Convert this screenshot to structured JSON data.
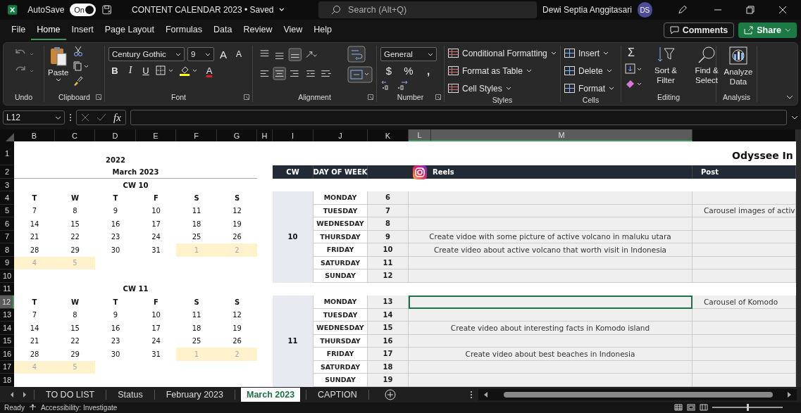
{
  "window": {
    "title": "CONTENT CALENDAR 2023 • Saved",
    "autosave": {
      "label": "AutoSave",
      "state_label": "On",
      "on": true
    },
    "search_placeholder": "Search (Alt+Q)",
    "user": "Dewi Septia Anggitasari",
    "initials": "DS"
  },
  "menu": [
    {
      "label": "File",
      "selected": false
    },
    {
      "label": "Home",
      "selected": true
    },
    {
      "label": "Insert",
      "selected": false
    },
    {
      "label": "Page Layout",
      "selected": false
    },
    {
      "label": "Formulas",
      "selected": false
    },
    {
      "label": "Data",
      "selected": false
    },
    {
      "label": "Review",
      "selected": false
    },
    {
      "label": "View",
      "selected": false
    },
    {
      "label": "Help",
      "selected": false
    }
  ],
  "comments": "Comments",
  "share": "Share",
  "ribbon": {
    "undo": {
      "label": "Undo"
    },
    "clipboard": {
      "paste": "Paste",
      "label": "Clipboard"
    },
    "font": {
      "name": "Century Gothic",
      "size": "9",
      "grow": "A",
      "shrink": "A",
      "bold": "B",
      "italic": "I",
      "underline": "U",
      "font_color": "A",
      "label": "Font"
    },
    "alignment": {
      "label": "Alignment"
    },
    "number": {
      "format": "General",
      "currency": "$",
      "percent": "%",
      "comma": ",",
      "label": "Number"
    },
    "styles": {
      "items": [
        "Conditional Formatting",
        "Format as Table",
        "Cell Styles"
      ],
      "label": "Styles"
    },
    "cells": {
      "items": [
        "Insert",
        "Delete",
        "Format"
      ],
      "label": "Cells"
    },
    "editing": {
      "sum": "Σ",
      "sort": "Sort & Filter",
      "find": "Find & Select",
      "label": "Editing"
    },
    "analysis": {
      "button": "Analyze Data",
      "label": "Analysis"
    }
  },
  "formula_bar": {
    "name_box": "L12",
    "fx": "fx"
  },
  "columns": [
    {
      "label": "B",
      "selected": false
    },
    {
      "label": "C",
      "selected": false
    },
    {
      "label": "D",
      "selected": false
    },
    {
      "label": "E",
      "selected": false
    },
    {
      "label": "F",
      "selected": false
    },
    {
      "label": "G",
      "selected": false
    },
    {
      "label": "H",
      "selected": false
    },
    {
      "label": "I",
      "selected": false
    },
    {
      "label": "J",
      "selected": false
    },
    {
      "label": "K",
      "selected": false
    },
    {
      "label": "L",
      "selected": true
    },
    {
      "label": "M",
      "selected": true
    }
  ],
  "rows": [
    {
      "label": "1",
      "selected": false
    },
    {
      "label": "2",
      "selected": false
    },
    {
      "label": "3",
      "selected": false
    },
    {
      "label": "4",
      "selected": false
    },
    {
      "label": "5",
      "selected": false
    },
    {
      "label": "6",
      "selected": false
    },
    {
      "label": "7",
      "selected": false
    },
    {
      "label": "8",
      "selected": false
    },
    {
      "label": "9",
      "selected": false
    },
    {
      "label": "10",
      "selected": false
    },
    {
      "label": "11",
      "selected": false
    },
    {
      "label": "12",
      "selected": true
    },
    {
      "label": "13",
      "selected": false
    },
    {
      "label": "14",
      "selected": false
    },
    {
      "label": "15",
      "selected": false
    },
    {
      "label": "16",
      "selected": false
    },
    {
      "label": "17",
      "selected": false
    },
    {
      "label": "18",
      "selected": false
    }
  ],
  "calendar": {
    "year": "2022",
    "month": "March 2023",
    "weeks": [
      {
        "label": "CW 10",
        "day_headers": [
          "T",
          "W",
          "T",
          "F",
          "S",
          "S"
        ],
        "dates": [
          [
            {
              "d": "7",
              "other_month": false
            },
            {
              "d": "8",
              "other_month": false
            },
            {
              "d": "9",
              "other_month": false
            },
            {
              "d": "10",
              "other_month": false
            },
            {
              "d": "11",
              "other_month": false
            },
            {
              "d": "12",
              "other_month": false
            }
          ],
          [
            {
              "d": "14",
              "other_month": false
            },
            {
              "d": "15",
              "other_month": false
            },
            {
              "d": "16",
              "other_month": false
            },
            {
              "d": "17",
              "other_month": false
            },
            {
              "d": "18",
              "other_month": false
            },
            {
              "d": "19",
              "other_month": false
            }
          ],
          [
            {
              "d": "21",
              "other_month": false
            },
            {
              "d": "22",
              "other_month": false
            },
            {
              "d": "23",
              "other_month": false
            },
            {
              "d": "24",
              "other_month": false
            },
            {
              "d": "25",
              "other_month": false
            },
            {
              "d": "26",
              "other_month": false
            }
          ],
          [
            {
              "d": "28",
              "other_month": false
            },
            {
              "d": "29",
              "other_month": false
            },
            {
              "d": "30",
              "other_month": false
            },
            {
              "d": "31",
              "other_month": false
            },
            {
              "d": "1",
              "other_month": true
            },
            {
              "d": "2",
              "other_month": true
            }
          ],
          [
            {
              "d": "4",
              "other_month": true
            },
            {
              "d": "5",
              "other_month": true
            }
          ]
        ]
      },
      {
        "label": "CW 11",
        "day_headers": [
          "T",
          "W",
          "T",
          "F",
          "S",
          "S"
        ],
        "dates": [
          [
            {
              "d": "7",
              "other_month": false
            },
            {
              "d": "8",
              "other_month": false
            },
            {
              "d": "9",
              "other_month": false
            },
            {
              "d": "10",
              "other_month": false
            },
            {
              "d": "11",
              "other_month": false
            },
            {
              "d": "12",
              "other_month": false
            }
          ],
          [
            {
              "d": "14",
              "other_month": false
            },
            {
              "d": "15",
              "other_month": false
            },
            {
              "d": "16",
              "other_month": false
            },
            {
              "d": "17",
              "other_month": false
            },
            {
              "d": "18",
              "other_month": false
            },
            {
              "d": "19",
              "other_month": false
            }
          ],
          [
            {
              "d": "21",
              "other_month": false
            },
            {
              "d": "22",
              "other_month": false
            },
            {
              "d": "23",
              "other_month": false
            },
            {
              "d": "24",
              "other_month": false
            },
            {
              "d": "25",
              "other_month": false
            },
            {
              "d": "26",
              "other_month": false
            }
          ],
          [
            {
              "d": "28",
              "other_month": false
            },
            {
              "d": "29",
              "other_month": false
            },
            {
              "d": "30",
              "other_month": false
            },
            {
              "d": "31",
              "other_month": false
            },
            {
              "d": "1",
              "other_month": true
            },
            {
              "d": "2",
              "other_month": true
            }
          ],
          [
            {
              "d": "4",
              "other_month": true
            },
            {
              "d": "5",
              "other_month": true
            }
          ]
        ]
      }
    ]
  },
  "schedule": {
    "title": "Odyssee In",
    "headers": {
      "cw": "CW",
      "day": "DAY OF WEEK",
      "reels": "Reels",
      "post": "Post"
    },
    "weeks": [
      {
        "cw": "10",
        "days": [
          {
            "day": "MONDAY",
            "date": "6",
            "selected": false
          },
          {
            "day": "TUESDAY",
            "date": "7",
            "post": "Carousel images of activ",
            "selected": false
          },
          {
            "day": "WEDNESDAY",
            "date": "8",
            "selected": false
          },
          {
            "day": "THURSDAY",
            "date": "9",
            "reels": "Create vidoe with some picture of active volcano in maluku utara",
            "selected": false
          },
          {
            "day": "FRIDAY",
            "date": "10",
            "reels": "Create video about active volcano that worth visit in Indonesia",
            "selected": false
          },
          {
            "day": "SATURDAY",
            "date": "11",
            "selected": false
          },
          {
            "day": "SUNDAY",
            "date": "12",
            "selected": false
          }
        ]
      },
      {
        "cw": "11",
        "days": [
          {
            "day": "MONDAY",
            "date": "13",
            "post": "Carousel of Komodo",
            "selected": true
          },
          {
            "day": "TUESDAY",
            "date": "14",
            "selected": false
          },
          {
            "day": "WEDNESDAY",
            "date": "15",
            "reels": "Create video about interesting facts in Komodo island",
            "selected": false
          },
          {
            "day": "THURSDAY",
            "date": "16",
            "selected": false
          },
          {
            "day": "FRIDAY",
            "date": "17",
            "reels": "Create video about best beaches in Indonesia",
            "selected": false
          },
          {
            "day": "SATURDAY",
            "date": "18",
            "selected": false
          },
          {
            "day": "SUNDAY",
            "date": "19",
            "selected": false
          }
        ]
      }
    ]
  },
  "sheets": [
    {
      "label": "TO DO LIST",
      "selected": false
    },
    {
      "label": "Status",
      "selected": false
    },
    {
      "label": "February 2023",
      "selected": false
    },
    {
      "label": "March 2023",
      "selected": true
    },
    {
      "label": "CAPTION",
      "selected": false
    }
  ],
  "status": {
    "ready": "Ready",
    "accessibility": "Accessibility: Investigate",
    "zoom": {
      "level": 0.5
    }
  }
}
